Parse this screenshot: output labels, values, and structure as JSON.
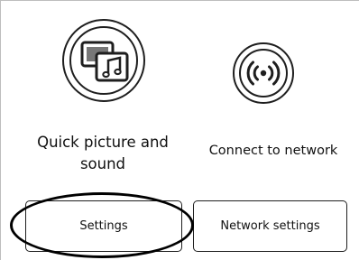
{
  "tiles": [
    {
      "id": "quick-picture",
      "title": "Quick picture and sound",
      "icon": "picture-sound-icon",
      "button_label": "Settings"
    },
    {
      "id": "connect-network",
      "title": "Connect to network",
      "icon": "wireless-signal-icon",
      "button_label": "Network settings"
    }
  ],
  "annotation": {
    "type": "ellipse",
    "marks": "tiles.0.button_label"
  }
}
